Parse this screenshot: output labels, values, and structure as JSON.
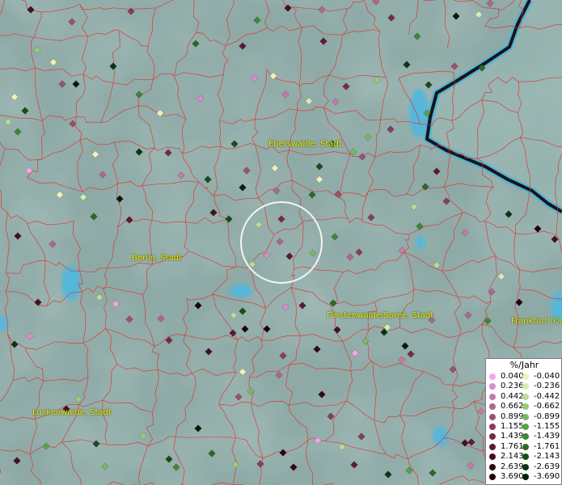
{
  "map": {
    "cities": [
      {
        "name": "Eberswalde, Stadt"
      },
      {
        "name": "Berlin, Stadt"
      },
      {
        "name": "Fürstenwalde/Spree, Stadt"
      },
      {
        "name": "Frankfurt (Oder)"
      },
      {
        "name": "Luckenwalde, Stadt"
      }
    ],
    "selection_circle": {
      "label": ""
    }
  },
  "legend": {
    "unit": "%/Jahr",
    "positive": [
      {
        "value": "0.040",
        "color": "#f2a6e4"
      },
      {
        "value": "0.236",
        "color": "#d98ec8"
      },
      {
        "value": "0.442",
        "color": "#c57aa6"
      },
      {
        "value": "0.662",
        "color": "#b0668c"
      },
      {
        "value": "0.899",
        "color": "#9c5070"
      },
      {
        "value": "1.155",
        "color": "#8a3c5c"
      },
      {
        "value": "1.439",
        "color": "#762a48"
      },
      {
        "value": "1.761",
        "color": "#5e1a34"
      },
      {
        "value": "2.143",
        "color": "#470e22"
      },
      {
        "value": "2.639",
        "color": "#320614"
      },
      {
        "value": "3.690",
        "color": "#1e0008"
      }
    ],
    "negative": [
      {
        "value": "-0.040",
        "color": "#f2f2b8"
      },
      {
        "value": "-0.236",
        "color": "#d8ecae"
      },
      {
        "value": "-0.442",
        "color": "#b8dc96"
      },
      {
        "value": "-0.662",
        "color": "#98cc7c"
      },
      {
        "value": "-0.899",
        "color": "#78b862"
      },
      {
        "value": "-1.155",
        "color": "#5aa04a"
      },
      {
        "value": "-1.439",
        "color": "#3e8636"
      },
      {
        "value": "-1.761",
        "color": "#286a26"
      },
      {
        "value": "-2.143",
        "color": "#184e18"
      },
      {
        "value": "-2.639",
        "color": "#0c340e"
      },
      {
        "value": "-3.690",
        "color": "#041e06"
      }
    ]
  }
}
